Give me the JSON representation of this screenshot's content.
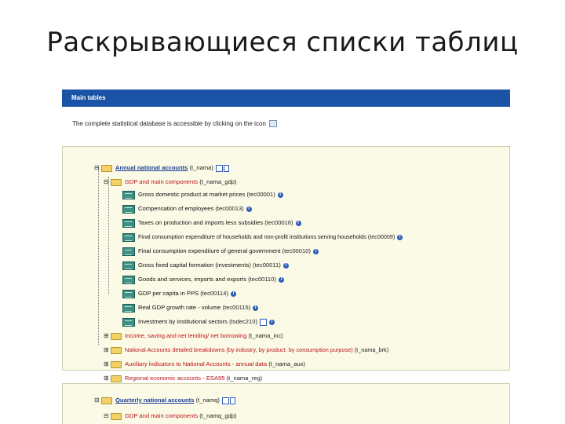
{
  "slide": {
    "title": "Раскрывающиеся списки таблиц"
  },
  "main_tables": {
    "header": "Main tables",
    "description": "The complete statistical database is accessible by clicking on the icon"
  },
  "tree": {
    "annual": {
      "label": "Annual national accounts",
      "code": "(t_nama)"
    },
    "gdp_folder": {
      "label": "GDP and main components",
      "code": "(t_nama_gdp)"
    },
    "tables": [
      {
        "label": "Gross domestic product at market prices",
        "code": "(tec00001)",
        "icon": "info-icon"
      },
      {
        "label": "Compensation of employees",
        "code": "(tec00013)",
        "icon": "info-icon"
      },
      {
        "label": "Taxes on production and imports less subsidies",
        "code": "(tec00016)",
        "icon": "info-icon"
      },
      {
        "label": "Final consumption expenditure of households and non-profit institutions serving households",
        "code": "(tec00009)",
        "icon": "info-icon"
      },
      {
        "label": "Final consumption expenditure of general government",
        "code": "(tec00010)",
        "icon": "info-icon"
      },
      {
        "label": "Gross fixed capital formation (investments)",
        "code": "(tec00011)",
        "icon": "info-icon"
      },
      {
        "label": "Goods and services, imports and exports",
        "code": "(tec00110)",
        "icon": "info-icon"
      },
      {
        "label": "GDP per capita in PPS",
        "code": "(tec00114)",
        "icon": "info-icon"
      },
      {
        "label": "Real GDP growth rate - volume",
        "code": "(tec00115)",
        "icon": "info-icon"
      },
      {
        "label": "Investment by institutional sectors",
        "code": "(tsdec210)",
        "icon": "doc-icon"
      }
    ],
    "folders": [
      {
        "label": "Income, saving and net lending/ net borrowing",
        "code": "(t_nama_inc)"
      },
      {
        "label": "National Accounts detailed breakdowns (by industry, by product, by consumption purpose)",
        "code": "(t_nama_brk)"
      },
      {
        "label": "Auxiliary indicators to National Accounts - annual data",
        "code": "(t_nama_aux)"
      },
      {
        "label": "Regional economic accounts - ESA95",
        "code": "(t_nama_reg)"
      }
    ],
    "quarterly": {
      "label": "Quarterly national accounts",
      "code": "(t_namq)"
    },
    "q_gdp_folder": {
      "label": "GDP and main components",
      "code": "(t_namq_gdp)"
    }
  },
  "colors": {
    "header_bg": "#1b54a6",
    "tree_bg": "#fbfae6",
    "link_red": "#b8121b",
    "link_blue": "#1b3f95",
    "table_icon": "#3d9184"
  }
}
